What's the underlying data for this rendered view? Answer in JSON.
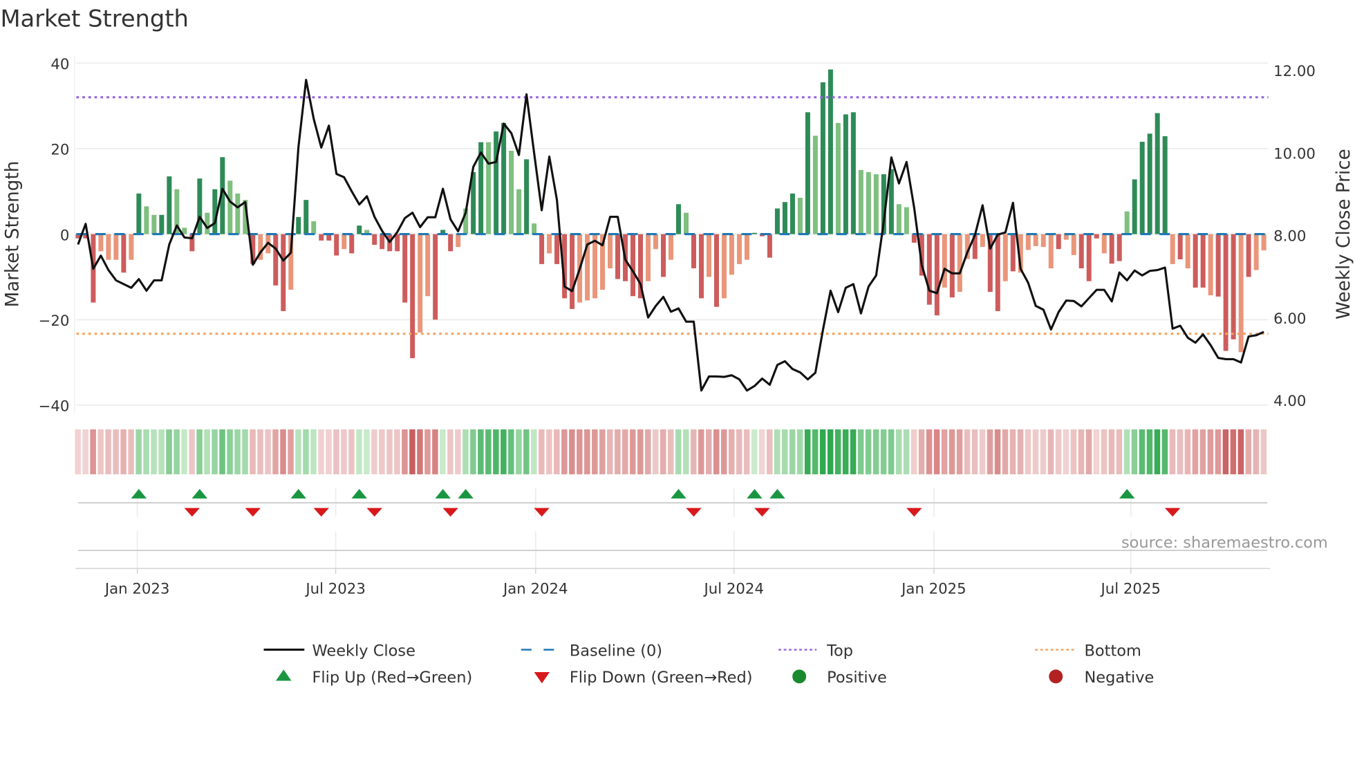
{
  "chart_data": {
    "type": "bar+line",
    "title": "Market Strength",
    "ylabel_left": "Market Strength",
    "ylabel_right": "Weekly Close Price",
    "ylim_left": [
      -40,
      40
    ],
    "ylim_right": [
      4.0,
      12.0
    ],
    "yticks_left": [
      {
        "v": 40,
        "label": "40"
      },
      {
        "v": 20,
        "label": "20"
      },
      {
        "v": 0,
        "label": "0"
      },
      {
        "v": -20,
        "label": "−20"
      },
      {
        "v": -40,
        "label": "−40"
      }
    ],
    "yticks_right": [
      {
        "v": 12,
        "label": "12.00"
      },
      {
        "v": 10,
        "label": "10.00"
      },
      {
        "v": 8,
        "label": "8.00"
      },
      {
        "v": 6,
        "label": "6.00"
      },
      {
        "v": 4,
        "label": "4.00"
      }
    ],
    "xticks": [
      {
        "week": 7.8,
        "label": "Jan 2023"
      },
      {
        "week": 33.9,
        "label": "Jul 2023"
      },
      {
        "week": 60.2,
        "label": "Jan 2024"
      },
      {
        "week": 86.3,
        "label": "Jul 2024"
      },
      {
        "week": 112.6,
        "label": "Jan 2025"
      },
      {
        "week": 138.5,
        "label": "Jul 2025"
      }
    ],
    "top_threshold": 32,
    "bottom_threshold": -23.3,
    "baseline": 0,
    "strength": [
      -1,
      -1,
      -16,
      -4,
      -6,
      -6,
      -9,
      -6,
      9.5,
      6.5,
      4.5,
      4.5,
      13.5,
      10.5,
      1.5,
      -4,
      13,
      5,
      10.5,
      18,
      12.5,
      9.5,
      8,
      -7,
      -6,
      -4.5,
      -12,
      -18,
      -13,
      4,
      8,
      3,
      -1.5,
      -1.5,
      -5,
      -3.5,
      -4.5,
      2,
      1,
      -2.5,
      -3.5,
      -4,
      -4,
      -16,
      -29,
      -23,
      -14.5,
      -20,
      1,
      -4,
      -3,
      6,
      14.5,
      21.5,
      21.5,
      24,
      26,
      19.5,
      10.5,
      17.5,
      2.5,
      -7,
      -4.5,
      -7,
      -15,
      -17.5,
      -16,
      -15.5,
      -15,
      -13,
      -8,
      -10.5,
      -11,
      -14.5,
      -15,
      -11,
      -3.5,
      -10,
      -6,
      7,
      5,
      -8,
      -15,
      -10,
      -17,
      -15,
      -9.5,
      -7,
      -6,
      0.3,
      -0.5,
      -5.5,
      6,
      7.5,
      9.5,
      8.5,
      28.5,
      23,
      35.5,
      38.5,
      26,
      28,
      28.5,
      15,
      14.5,
      14,
      14,
      15.2,
      7,
      6.3,
      -2,
      -9.7,
      -16.5,
      -19,
      -12.5,
      -14.8,
      -13.5,
      -5.8,
      -5.8,
      -3,
      -13.5,
      -18,
      -11,
      -8.7,
      -9,
      -3.7,
      -2.8,
      -3,
      -8,
      -3.5,
      -1.3,
      -4.9,
      -8,
      -11,
      -1,
      -4.5,
      -6.9,
      -6.3,
      5.3,
      12.8,
      21.6,
      23.5,
      28.3,
      22.9,
      -7,
      -5.9,
      -8,
      -12.5,
      -12.5,
      -14.3,
      -14.6,
      -27.3,
      -24.6,
      -27.6,
      -10,
      -8.4,
      -3.8
    ],
    "shade": "dddllldldllddllddlddllldllddlddldddlddlddddddllddd llddlddlldldldddlllllddddlldldlddldllllddddddldlddlddllldd llddddldlldlddldllllldlldddlddldddddldlddldddldlll",
    "price": [
      7.77,
      8.27,
      7.18,
      7.5,
      7.15,
      6.9,
      6.81,
      6.72,
      6.93,
      6.65,
      6.9,
      6.9,
      7.77,
      8.23,
      7.94,
      7.92,
      8.44,
      8.17,
      8.29,
      9.12,
      8.81,
      8.67,
      8.8,
      7.28,
      7.58,
      7.81,
      7.67,
      7.38,
      7.57,
      10.14,
      11.76,
      10.82,
      10.12,
      10.65,
      9.48,
      9.4,
      9.06,
      8.74,
      8.94,
      8.44,
      8.1,
      7.83,
      8.07,
      8.41,
      8.54,
      8.19,
      8.43,
      8.43,
      9.12,
      8.38,
      8.09,
      8.54,
      9.65,
      10.0,
      9.73,
      9.77,
      10.7,
      10.47,
      9.94,
      11.41,
      9.99,
      8.6,
      9.9,
      8.85,
      6.75,
      6.64,
      7.18,
      7.77,
      7.86,
      7.75,
      8.44,
      8.44,
      7.4,
      7.12,
      6.81,
      6.0,
      6.28,
      6.5,
      6.14,
      6.22,
      5.9,
      5.9,
      4.23,
      4.57,
      4.57,
      4.56,
      4.6,
      4.5,
      4.23,
      4.34,
      4.52,
      4.37,
      4.85,
      4.94,
      4.75,
      4.67,
      4.5,
      4.66,
      5.7,
      6.65,
      6.13,
      6.72,
      6.81,
      6.1,
      6.75,
      7.02,
      8.32,
      9.88,
      9.25,
      9.77,
      8.66,
      7.27,
      6.65,
      6.59,
      7.18,
      7.07,
      7.07,
      7.58,
      8.0,
      8.72,
      7.67,
      8.01,
      8.06,
      8.78,
      7.18,
      6.84,
      6.28,
      6.19,
      5.71,
      6.13,
      6.41,
      6.4,
      6.27,
      6.47,
      6.67,
      6.67,
      6.39,
      7.09,
      6.9,
      7.14,
      7.02,
      7.13,
      7.15,
      7.21,
      5.73,
      5.8,
      5.51,
      5.39,
      5.59,
      5.33,
      5.02,
      4.99,
      4.99,
      4.91,
      5.54,
      5.57,
      5.65
    ],
    "flip_up_weeks": [
      8,
      16,
      29,
      37,
      48,
      51,
      79,
      89,
      92,
      138
    ],
    "flip_down_weeks": [
      15,
      23,
      32,
      39,
      49,
      61,
      81,
      90,
      110,
      144
    ],
    "colors": {
      "pos_dark": "#2e8b57",
      "pos_light": "#7fbf7f",
      "neg_dark": "#cd5c5c",
      "neg_light": "#e9967a",
      "price": "#111111",
      "baseline": "#1f77b4",
      "top": "#9966dd",
      "bottom": "#f4a460",
      "flip_up": "#1a9641",
      "flip_down": "#d7191c",
      "positive": "#1a8a2e",
      "negative": "#b22222"
    },
    "legend": {
      "weekly_close": "Weekly Close",
      "baseline": "Baseline (0)",
      "top": "Top",
      "bottom": "Bottom",
      "flip_up": "Flip Up (Red→Green)",
      "flip_down": "Flip Down (Green→Red)",
      "positive": "Positive",
      "negative": "Negative"
    },
    "source": "source: sharemaestro.com"
  }
}
